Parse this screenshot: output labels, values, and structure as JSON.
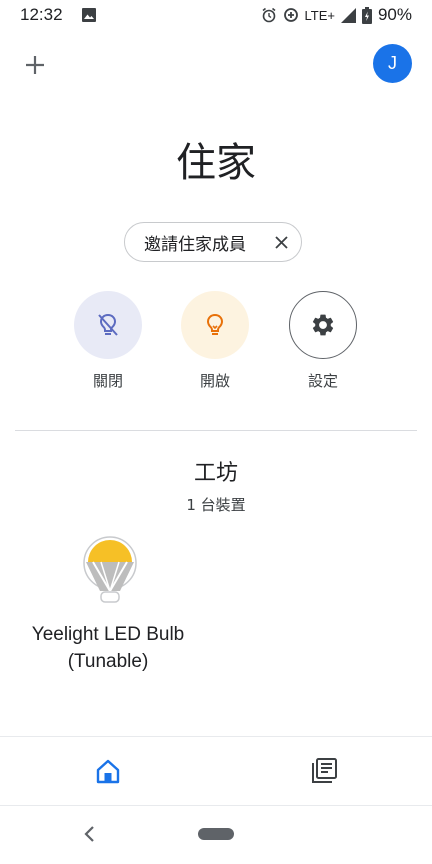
{
  "status_bar": {
    "time": "12:32",
    "network": "LTE+",
    "battery": "90%",
    "icons": [
      "photo-icon",
      "alarm-icon",
      "data-saver-icon",
      "signal-icon",
      "battery-icon"
    ]
  },
  "header": {
    "add_icon": "plus-icon",
    "avatar_letter": "J"
  },
  "home": {
    "title": "住家",
    "invite_chip": {
      "label": "邀請住家成員",
      "close_icon": "close-icon"
    }
  },
  "actions": [
    {
      "label": "關閉",
      "icon": "light-off-icon"
    },
    {
      "label": "開啟",
      "icon": "light-on-icon"
    },
    {
      "label": "設定",
      "icon": "gear-icon"
    }
  ],
  "room": {
    "name": "工坊",
    "device_count": "1 台裝置",
    "devices": [
      {
        "name_line1": "Yeelight LED Bulb",
        "name_line2": "(Tunable)",
        "icon": "bulb-icon"
      }
    ]
  },
  "bottom_nav": {
    "items": [
      {
        "icon": "home-icon",
        "active": true
      },
      {
        "icon": "feed-icon",
        "active": false
      }
    ]
  },
  "colors": {
    "accent": "#1a73e8",
    "off_bg": "#e8eaf6",
    "off_fg": "#5c6bc0",
    "on_bg": "#fdf3e0",
    "on_fg": "#e8710a",
    "bulb_yellow": "#f6c026"
  }
}
